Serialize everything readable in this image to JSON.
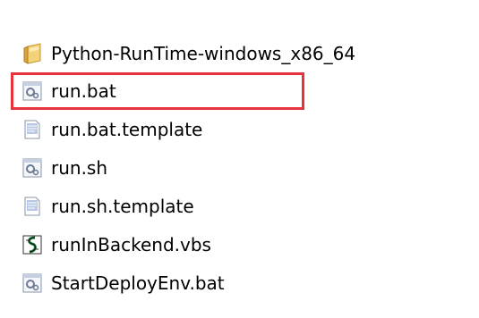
{
  "files": [
    {
      "name": "Python-RunTime-windows_x86_64",
      "icon": "folder-icon"
    },
    {
      "name": "run.bat",
      "icon": "batch-file-icon",
      "selected": true
    },
    {
      "name": "run.bat.template",
      "icon": "text-file-icon"
    },
    {
      "name": "run.sh",
      "icon": "batch-file-icon"
    },
    {
      "name": "run.sh.template",
      "icon": "text-file-icon"
    },
    {
      "name": "runInBackend.vbs",
      "icon": "vbscript-file-icon"
    },
    {
      "name": "StartDeployEnv.bat",
      "icon": "batch-file-icon"
    }
  ],
  "colors": {
    "selection_border": "#e8333d",
    "folder": "#e8b84a"
  }
}
